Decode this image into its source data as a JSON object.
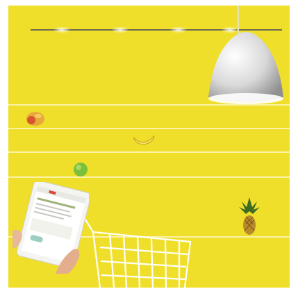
{
  "scene": {
    "background_color": "#f0df2a",
    "stripe_color": "#fbf4b4",
    "objects": [
      "ceiling-rail",
      "pendant-lamp",
      "mango",
      "banana",
      "lime",
      "pineapple",
      "tablet",
      "shopping-cart",
      "hands"
    ]
  }
}
